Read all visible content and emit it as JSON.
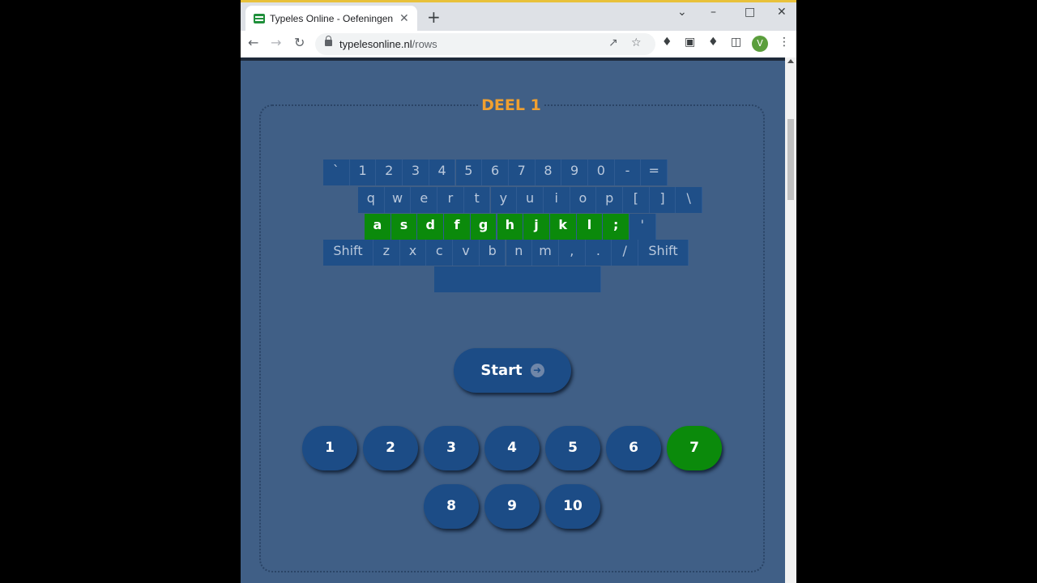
{
  "browser": {
    "tab_title": "Typeles Online - Oefeningen",
    "tab_close": "✕",
    "new_tab": "+",
    "url_host": "typelesonline.nl",
    "url_path": "/rows",
    "avatar_letter": "V"
  },
  "page": {
    "legend": "DEEL 1",
    "start_label": "Start",
    "accent_home_row": "#0b8a0b"
  },
  "keyboard": {
    "row1": [
      "`",
      "1",
      "2",
      "3",
      "4",
      "5",
      "6",
      "7",
      "8",
      "9",
      "0",
      "-",
      "="
    ],
    "row2": [
      "q",
      "w",
      "e",
      "r",
      "t",
      "y",
      "u",
      "i",
      "o",
      "p",
      "[",
      "]",
      "\\"
    ],
    "row3": [
      "a",
      "s",
      "d",
      "f",
      "g",
      "h",
      "j",
      "k",
      "l",
      ";",
      "'"
    ],
    "row4": [
      "Shift",
      "z",
      "x",
      "c",
      "v",
      "b",
      "n",
      "m",
      ",",
      ".",
      "/",
      "Shift"
    ]
  },
  "lessons": [
    "1",
    "2",
    "3",
    "4",
    "5",
    "6",
    "7",
    "8",
    "9",
    "10"
  ],
  "active_lesson": "7"
}
